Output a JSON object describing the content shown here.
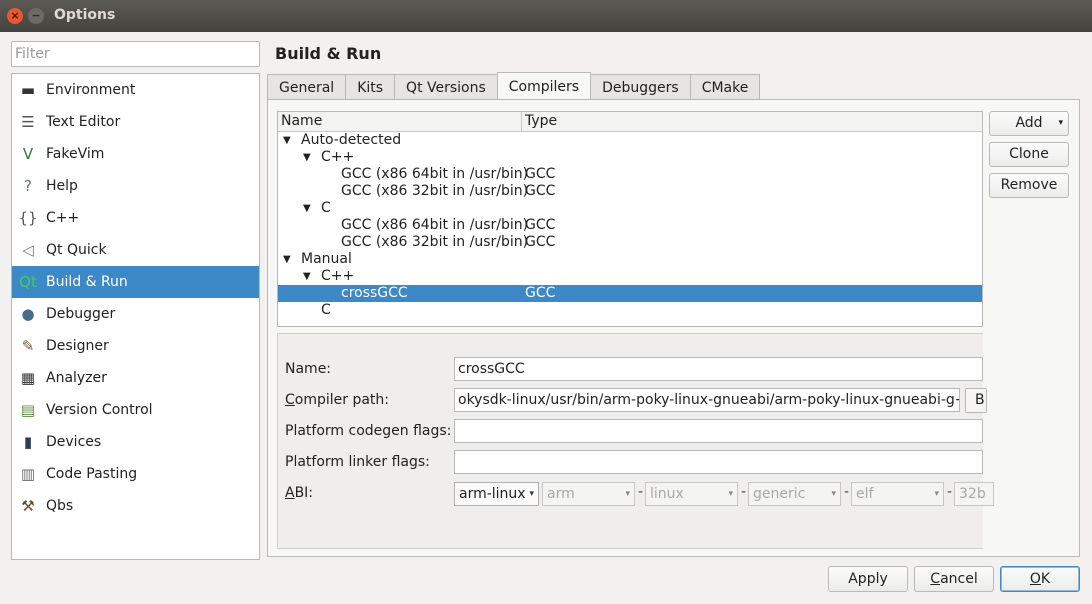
{
  "window": {
    "title": "Options",
    "close_glyph": "×",
    "minimize_glyph": "−"
  },
  "filter": {
    "placeholder": "Filter"
  },
  "nav": [
    {
      "label": "Environment",
      "icon": "monitor-icon",
      "glyph": "▬",
      "color": "#333333"
    },
    {
      "label": "Text Editor",
      "icon": "text-editor-icon",
      "glyph": "☰",
      "color": "#555555"
    },
    {
      "label": "FakeVim",
      "icon": "fakevim-icon",
      "glyph": "V",
      "color": "#2e7d32"
    },
    {
      "label": "Help",
      "icon": "help-icon",
      "glyph": "?",
      "color": "#5b6e8c"
    },
    {
      "label": "C++",
      "icon": "braces-icon",
      "glyph": "{}",
      "color": "#555555"
    },
    {
      "label": "Qt Quick",
      "icon": "paper-plane-icon",
      "glyph": "◁",
      "color": "#777777"
    },
    {
      "label": "Build & Run",
      "icon": "qt-build-icon",
      "glyph": "Qt",
      "color": "#41cd52"
    },
    {
      "label": "Debugger",
      "icon": "debugger-icon",
      "glyph": "●",
      "color": "#4a6a8a"
    },
    {
      "label": "Designer",
      "icon": "designer-tools-icon",
      "glyph": "✎",
      "color": "#7a5a3a"
    },
    {
      "label": "Analyzer",
      "icon": "analyzer-icon",
      "glyph": "▦",
      "color": "#333333"
    },
    {
      "label": "Version Control",
      "icon": "version-control-icon",
      "glyph": "▤",
      "color": "#5a8a3a"
    },
    {
      "label": "Devices",
      "icon": "device-icon",
      "glyph": "▮",
      "color": "#2a3a5a"
    },
    {
      "label": "Code Pasting",
      "icon": "code-pasting-icon",
      "glyph": "▥",
      "color": "#6a6a6a"
    },
    {
      "label": "Qbs",
      "icon": "hammer-icon",
      "glyph": "⚒",
      "color": "#6a4a2a"
    }
  ],
  "nav_selected_index": 6,
  "page_title": "Build & Run",
  "tabs": [
    "General",
    "Kits",
    "Qt Versions",
    "Compilers",
    "Debuggers",
    "CMake"
  ],
  "active_tab": "Compilers",
  "tree": {
    "columns": [
      "Name",
      "Type"
    ],
    "rows": [
      {
        "depth": 0,
        "arrow": "▼",
        "name": "Auto-detected",
        "type": ""
      },
      {
        "depth": 1,
        "arrow": "▼",
        "name": "C++",
        "type": ""
      },
      {
        "depth": 2,
        "arrow": "",
        "name": "GCC (x86 64bit in /usr/bin)",
        "type": "GCC"
      },
      {
        "depth": 2,
        "arrow": "",
        "name": "GCC (x86 32bit in /usr/bin)",
        "type": "GCC"
      },
      {
        "depth": 1,
        "arrow": "▼",
        "name": "C",
        "type": ""
      },
      {
        "depth": 2,
        "arrow": "",
        "name": "GCC (x86 64bit in /usr/bin)",
        "type": "GCC"
      },
      {
        "depth": 2,
        "arrow": "",
        "name": "GCC (x86 32bit in /usr/bin)",
        "type": "GCC"
      },
      {
        "depth": 0,
        "arrow": "▼",
        "name": "Manual",
        "type": ""
      },
      {
        "depth": 1,
        "arrow": "▼",
        "name": "C++",
        "type": ""
      },
      {
        "depth": 2,
        "arrow": "",
        "name": "crossGCC",
        "type": "GCC",
        "selected": true
      },
      {
        "depth": 1,
        "arrow": "",
        "name": "C",
        "type": ""
      }
    ]
  },
  "buttons": {
    "add": "Add",
    "add_dropdown": "▾",
    "clone": "Clone",
    "remove": "Remove"
  },
  "form": {
    "name_label": "Name:",
    "name_value": "crossGCC",
    "compiler_path_label_mnemonic": "C",
    "compiler_path_label_rest": "ompiler path:",
    "compiler_path_value": "okysdk-linux/usr/bin/arm-poky-linux-gnueabi/arm-poky-linux-gnueabi-g++",
    "browse_label": "B",
    "codegen_label": "Platform codegen flags:",
    "codegen_value": "",
    "linker_label": "Platform linker flags:",
    "linker_value": "",
    "abi_label_mnemonic": "A",
    "abi_label_rest": "BI:",
    "abi_combos": [
      "arm-linux",
      "arm",
      "linux",
      "generic",
      "elf",
      "32b"
    ],
    "abi_separator": "-",
    "dropdown_glyph": "▾"
  },
  "footer": {
    "apply": "Apply",
    "cancel_mnemonic": "C",
    "cancel_rest": "ancel",
    "ok_mnemonic": "O",
    "ok_rest": "K"
  }
}
